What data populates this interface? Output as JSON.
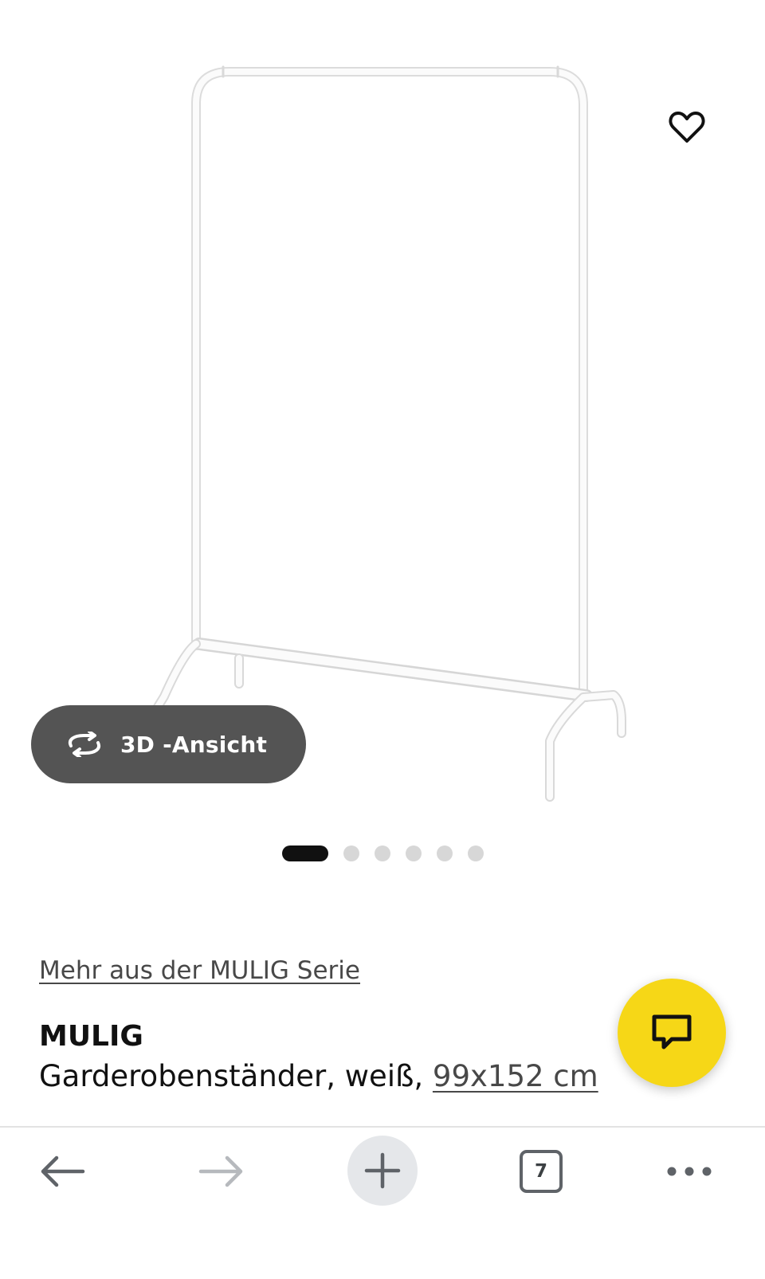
{
  "product": {
    "series_link": "Mehr aus der MULIG Serie",
    "name": "MULIG",
    "description_prefix": "Garderobenständer, weiß, ",
    "dimension": "99x152 cm"
  },
  "gallery": {
    "view3d_label": "3D -Ansicht",
    "slides_total": 6,
    "active_slide": 1
  },
  "browser": {
    "tab_count": "7"
  },
  "colors": {
    "accent_yellow": "#f6d717",
    "view3d_bg": "#545454",
    "pager_active": "#111111",
    "pager_inactive": "#d7d7d7"
  },
  "icons": [
    "heart-icon",
    "rotate-3d-icon",
    "chat-icon",
    "back-arrow-icon",
    "forward-arrow-icon",
    "plus-icon",
    "tabs-icon",
    "more-dots-icon"
  ]
}
